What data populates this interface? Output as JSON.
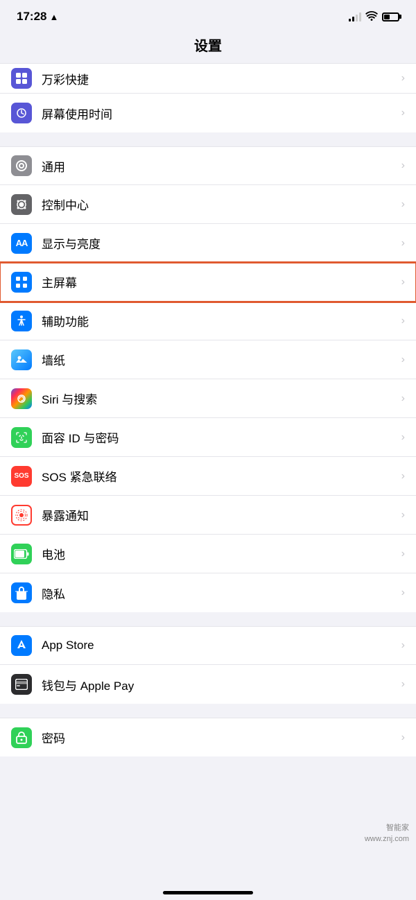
{
  "statusBar": {
    "time": "17:28",
    "hasLocation": true
  },
  "pageTitle": "设置",
  "sections": [
    {
      "id": "section1",
      "items": [
        {
          "id": "shortcuts",
          "label": "万彩快捷",
          "iconClass": "icon-screen-time",
          "iconSymbol": "⌛",
          "partial": true
        },
        {
          "id": "screen-time",
          "label": "屏幕使用时间",
          "iconClass": "icon-screen-time",
          "iconSymbol": "⌛"
        }
      ]
    },
    {
      "id": "section2",
      "items": [
        {
          "id": "general",
          "label": "通用",
          "iconClass": "icon-general",
          "iconSymbol": "⚙"
        },
        {
          "id": "control-center",
          "label": "控制中心",
          "iconClass": "icon-control",
          "iconSymbol": "⊙"
        },
        {
          "id": "display",
          "label": "显示与亮度",
          "iconClass": "icon-display",
          "iconSymbol": "AA"
        },
        {
          "id": "home-screen",
          "label": "主屏幕",
          "iconClass": "icon-home",
          "iconSymbol": "⊞",
          "highlighted": true
        },
        {
          "id": "accessibility",
          "label": "辅助功能",
          "iconClass": "icon-accessibility",
          "iconSymbol": "♿"
        },
        {
          "id": "wallpaper",
          "label": "墙纸",
          "iconClass": "icon-wallpaper",
          "iconSymbol": "✿"
        },
        {
          "id": "siri",
          "label": "Siri 与搜索",
          "iconClass": "icon-siri",
          "iconSymbol": "◎"
        },
        {
          "id": "faceid",
          "label": "面容 ID 与密码",
          "iconClass": "icon-faceid",
          "iconSymbol": "☺"
        },
        {
          "id": "sos",
          "label": "SOS 紧急联络",
          "iconClass": "icon-sos",
          "iconSymbol": "SOS"
        },
        {
          "id": "exposure",
          "label": "暴露通知",
          "iconClass": "icon-exposure",
          "iconSymbol": "◌"
        },
        {
          "id": "battery",
          "label": "电池",
          "iconClass": "icon-battery",
          "iconSymbol": "▬"
        },
        {
          "id": "privacy",
          "label": "隐私",
          "iconClass": "icon-privacy",
          "iconSymbol": "✋"
        }
      ]
    },
    {
      "id": "section3",
      "items": [
        {
          "id": "app-store",
          "label": "App Store",
          "iconClass": "icon-appstore",
          "iconSymbol": "A"
        },
        {
          "id": "wallet",
          "label": "钱包与 Apple Pay",
          "iconClass": "icon-wallet",
          "iconSymbol": "≡"
        }
      ]
    },
    {
      "id": "section4",
      "items": [
        {
          "id": "passwords",
          "label": "密码",
          "iconClass": "icon-passwords",
          "iconSymbol": "🔑",
          "partial": true
        }
      ]
    }
  ],
  "watermark": {
    "line1": "智能家",
    "line2": "www.znj.com"
  }
}
